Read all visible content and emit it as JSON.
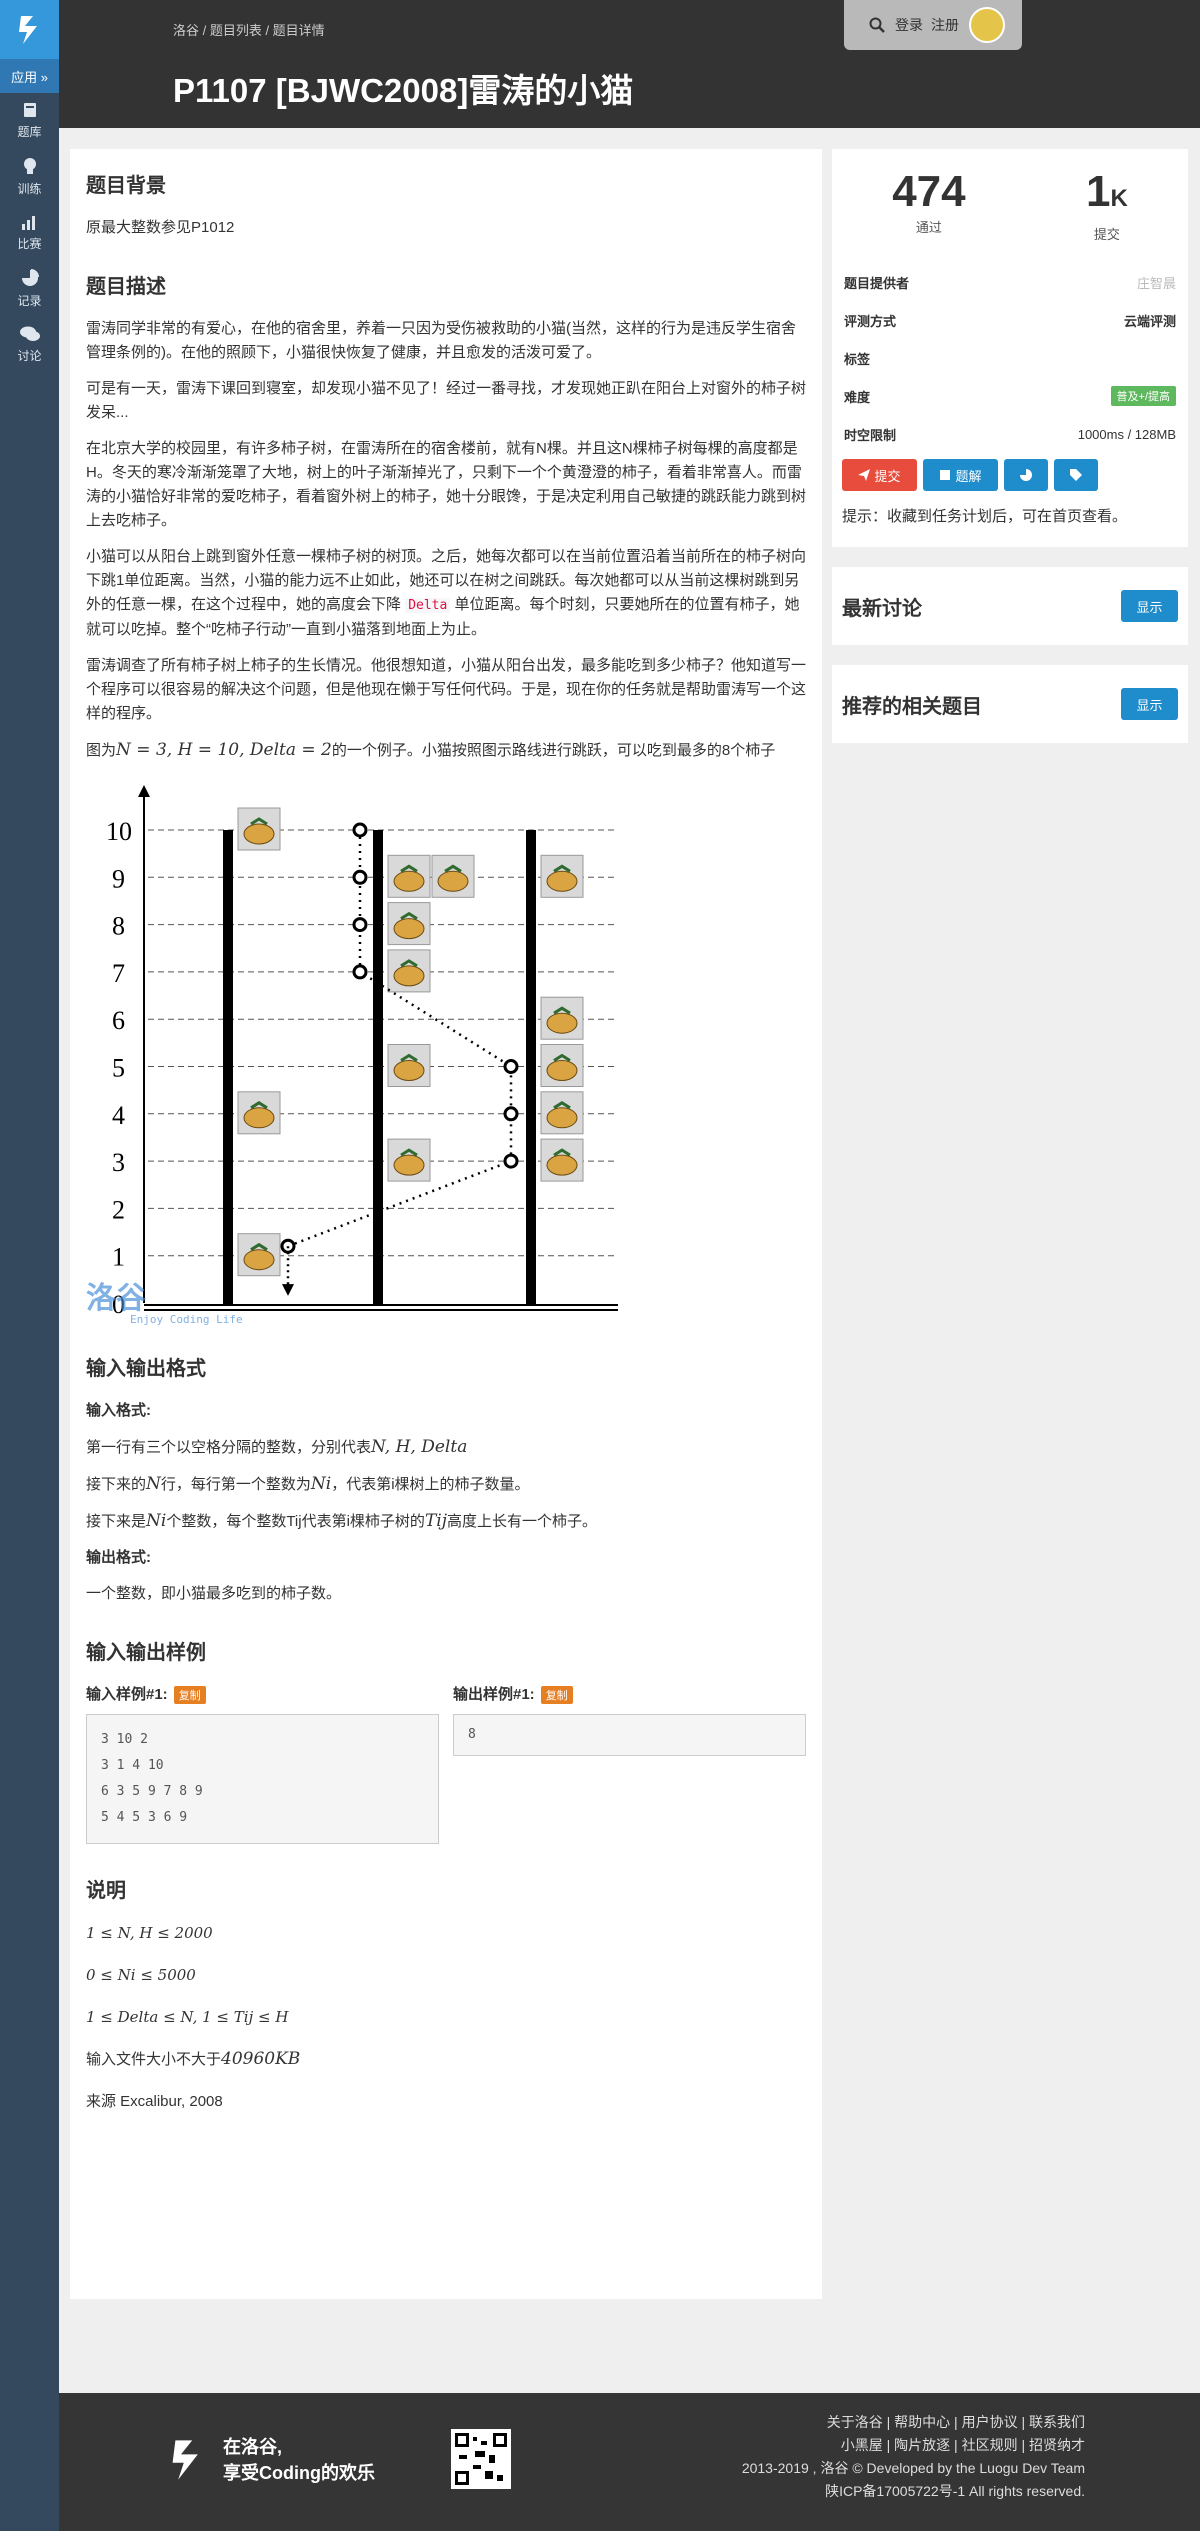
{
  "sidebar": {
    "app_label": "应用 »",
    "items": [
      {
        "icon": "book-icon",
        "label": "题库"
      },
      {
        "icon": "bulb-icon",
        "label": "训练"
      },
      {
        "icon": "bar-chart-icon",
        "label": "比赛"
      },
      {
        "icon": "pie-chart-icon",
        "label": "记录"
      },
      {
        "icon": "chat-icon",
        "label": "讨论"
      }
    ]
  },
  "header": {
    "breadcrumb": "洛谷 / 题目列表 / 题目详情",
    "title": "P1107 [BJWC2008]雷涛的小猫",
    "login": "登录",
    "register": "注册"
  },
  "problem": {
    "background_title": "题目背景",
    "background": "原最大整数参见P1012",
    "desc_title": "题目描述",
    "p1": "雷涛同学非常的有爱心，在他的宿舍里，养着一只因为受伤被救助的小猫(当然，这样的行为是违反学生宿舍管理条例的)。在他的照顾下，小猫很快恢复了健康，并且愈发的活泼可爱了。",
    "p2": "可是有一天，雷涛下课回到寝室，却发现小猫不见了！经过一番寻找，才发现她正趴在阳台上对窗外的柿子树发呆...",
    "p3": "在北京大学的校园里，有许多柿子树，在雷涛所在的宿舍楼前，就有N棵。并且这N棵柿子树每棵的高度都是H。冬天的寒冷渐渐笼罩了大地，树上的叶子渐渐掉光了，只剩下一个个黄澄澄的柿子，看着非常喜人。而雷涛的小猫恰好非常的爱吃柿子，看着窗外树上的柿子，她十分眼馋，于是决定利用自己敏捷的跳跃能力跳到树上去吃柿子。",
    "p4a": "小猫可以从阳台上跳到窗外任意一棵柿子树的树顶。之后，她每次都可以在当前位置沿着当前所在的柿子树向下跳1单位距离。当然，小猫的能力远不止如此，她还可以在树之间跳跃。每次她都可以从当前这棵树跳到另外的任意一棵，在这个过程中，她的高度会下降",
    "p4code": "Delta",
    "p4b": "单位距离。每个时刻，只要她所在的位置有柿子，她就可以吃掉。整个“吃柿子行动”一直到小猫落到地面上为止。",
    "p5": "雷涛调查了所有柿子树上柿子的生长情况。他很想知道，小猫从阳台出发，最多能吃到多少柿子？他知道写一个程序可以很容易的解决这个问题，但是他现在懒于写任何代码。于是，现在你的任务就是帮助雷涛写一个这样的程序。",
    "p6a": "图为",
    "p6math": "N = 3, H = 10, Delta = 2",
    "p6b": "的一个例子。小猫按照图示路线进行跳跃，可以吃到最多的8个柿子",
    "io_title": "输入输出格式",
    "in_label": "输入格式:",
    "in1a": "第一行有三个以空格分隔的整数，分别代表",
    "in1math": "N, H, Delta",
    "in2a": "接下来的",
    "in2math": "N",
    "in2b": "行，每行第一个整数为",
    "in2math2": "Ni",
    "in2c": "，代表第i棵树上的柿子数量。",
    "in3a": "接下来是",
    "in3math": "Ni",
    "in3b": "个整数，每个整数Tij代表第i棵柿子树的",
    "in3math2": "Tij",
    "in3c": "高度上长有一个柿子。",
    "out_label": "输出格式:",
    "out1": "一个整数，即小猫最多吃到的柿子数。",
    "sample_title": "输入输出样例",
    "sample_in_label": "输入样例#1:",
    "sample_out_label": "输出样例#1:",
    "copy": "复制",
    "sample_in": "3 10 2\n3 1 4 10\n6 3 5 9 7 8 9\n5 4 5 3 6 9",
    "sample_out": "8",
    "note_title": "说明",
    "note1": "1 ≤ N, H ≤ 2000",
    "note2": "0 ≤ Ni ≤ 5000",
    "note3": "1 ≤ Delta ≤ N, 1 ≤ Tij ≤ H",
    "note4a": "输入文件大小不大于",
    "note4math": "40960KB",
    "note5": "来源 Excalibur, 2008"
  },
  "figure": {
    "y_ticks": [
      "0",
      "1",
      "2",
      "3",
      "4",
      "5",
      "6",
      "7",
      "8",
      "9",
      "10"
    ],
    "watermark": "洛谷",
    "watermark_sub": "Enjoy Coding Life"
  },
  "side": {
    "passed": "474",
    "passed_label": "通过",
    "submits": "1",
    "submits_unit": "K",
    "submits_label": "提交",
    "provider_k": "题目提供者",
    "provider_v": "庄智晨",
    "judge_k": "评测方式",
    "judge_v": "云端评测",
    "tags_k": "标签",
    "diff_k": "难度",
    "diff_v": "普及+/提高",
    "limit_k": "时空限制",
    "limit_v": "1000ms / 128MB",
    "btn_submit": "提交",
    "btn_solution": "题解",
    "tip": "提示：收藏到任务计划后，可在首页查看。",
    "discuss_title": "最新讨论",
    "related_title": "推荐的相关题目",
    "show": "显示"
  },
  "footer": {
    "slogan1": "在洛谷,",
    "slogan2": "享受Coding的欢乐",
    "links1": "关于洛谷 | 帮助中心 | 用户协议 | 联系我们",
    "links2": "小黑屋 | 陶片放逐 | 社区规则 | 招贤纳才",
    "copyright": "2013-2019 , 洛谷 © Developed by the Luogu Dev Team",
    "icp": "陕ICP备17005722号-1 All rights reserved."
  },
  "colors": {
    "sidebar": "#34495e",
    "accent": "#3498db",
    "red": "#e74c3c",
    "blue": "#1f8ccc",
    "green": "#5eb95e",
    "orange": "#e67e22"
  }
}
